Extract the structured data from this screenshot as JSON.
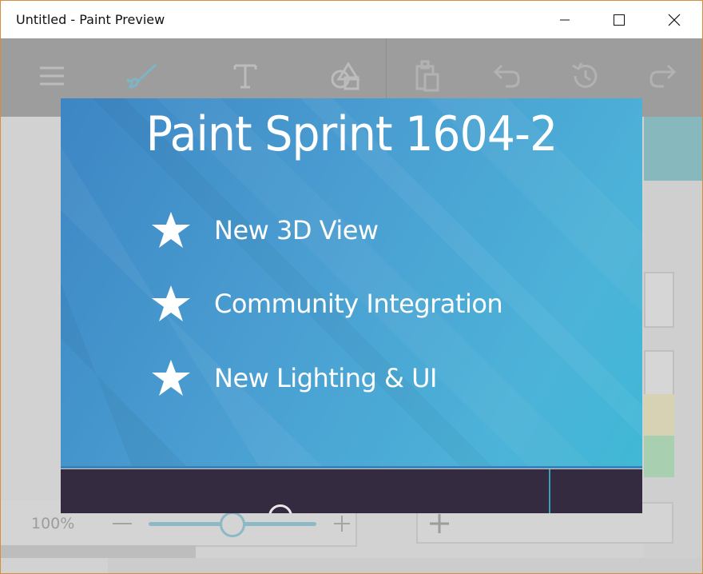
{
  "window": {
    "title": "Untitled - Paint Preview"
  },
  "toolbar": {
    "icons": [
      "menu-icon",
      "brush-icon",
      "text-icon",
      "shapes-icon",
      "paste-icon",
      "undo-icon",
      "history-icon",
      "redo-icon"
    ]
  },
  "zoom": {
    "label": "100%",
    "level_percent": 100
  },
  "dialog": {
    "title": "Paint Sprint 1604-2",
    "features": [
      {
        "icon": "star-icon",
        "label": "New 3D View"
      },
      {
        "icon": "star-icon",
        "label": "Community Integration"
      },
      {
        "icon": "star-icon",
        "label": "New Lighting & UI"
      }
    ]
  },
  "colors": {
    "dialog_gradient_start": "#3d86c4",
    "dialog_gradient_end": "#3fb8d6",
    "dialog_footer": "#342b40",
    "toolbar_dimmed": "#9d9d9d",
    "accent_teal": "#86b8bd"
  }
}
